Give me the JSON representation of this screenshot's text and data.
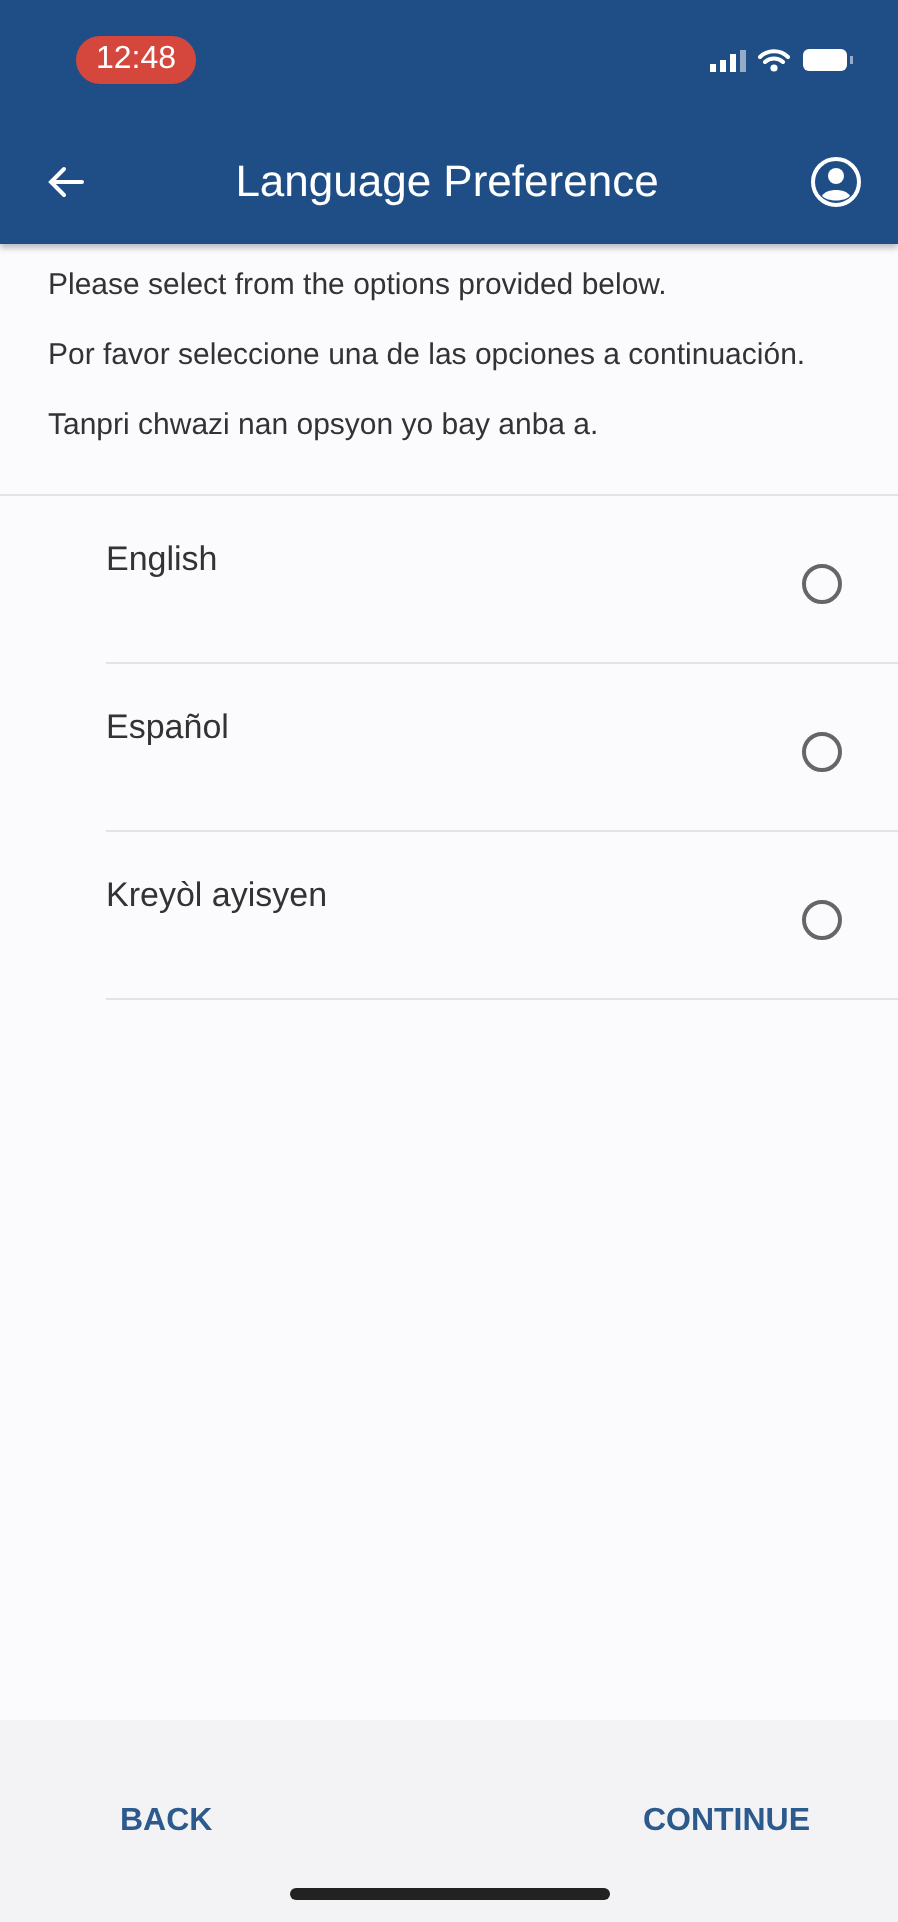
{
  "status_bar": {
    "time": "12:48"
  },
  "header": {
    "title": "Language Preference"
  },
  "intro": [
    "Please select from the options provided below.",
    "Por favor seleccione una de las opciones a continuación.",
    "Tanpri chwazi nan opsyon yo bay anba a."
  ],
  "options": [
    {
      "label": "English",
      "selected": false
    },
    {
      "label": "Español",
      "selected": false
    },
    {
      "label": "Kreyòl ayisyen",
      "selected": false
    }
  ],
  "footer": {
    "back": "BACK",
    "continue": "CONTINUE"
  }
}
